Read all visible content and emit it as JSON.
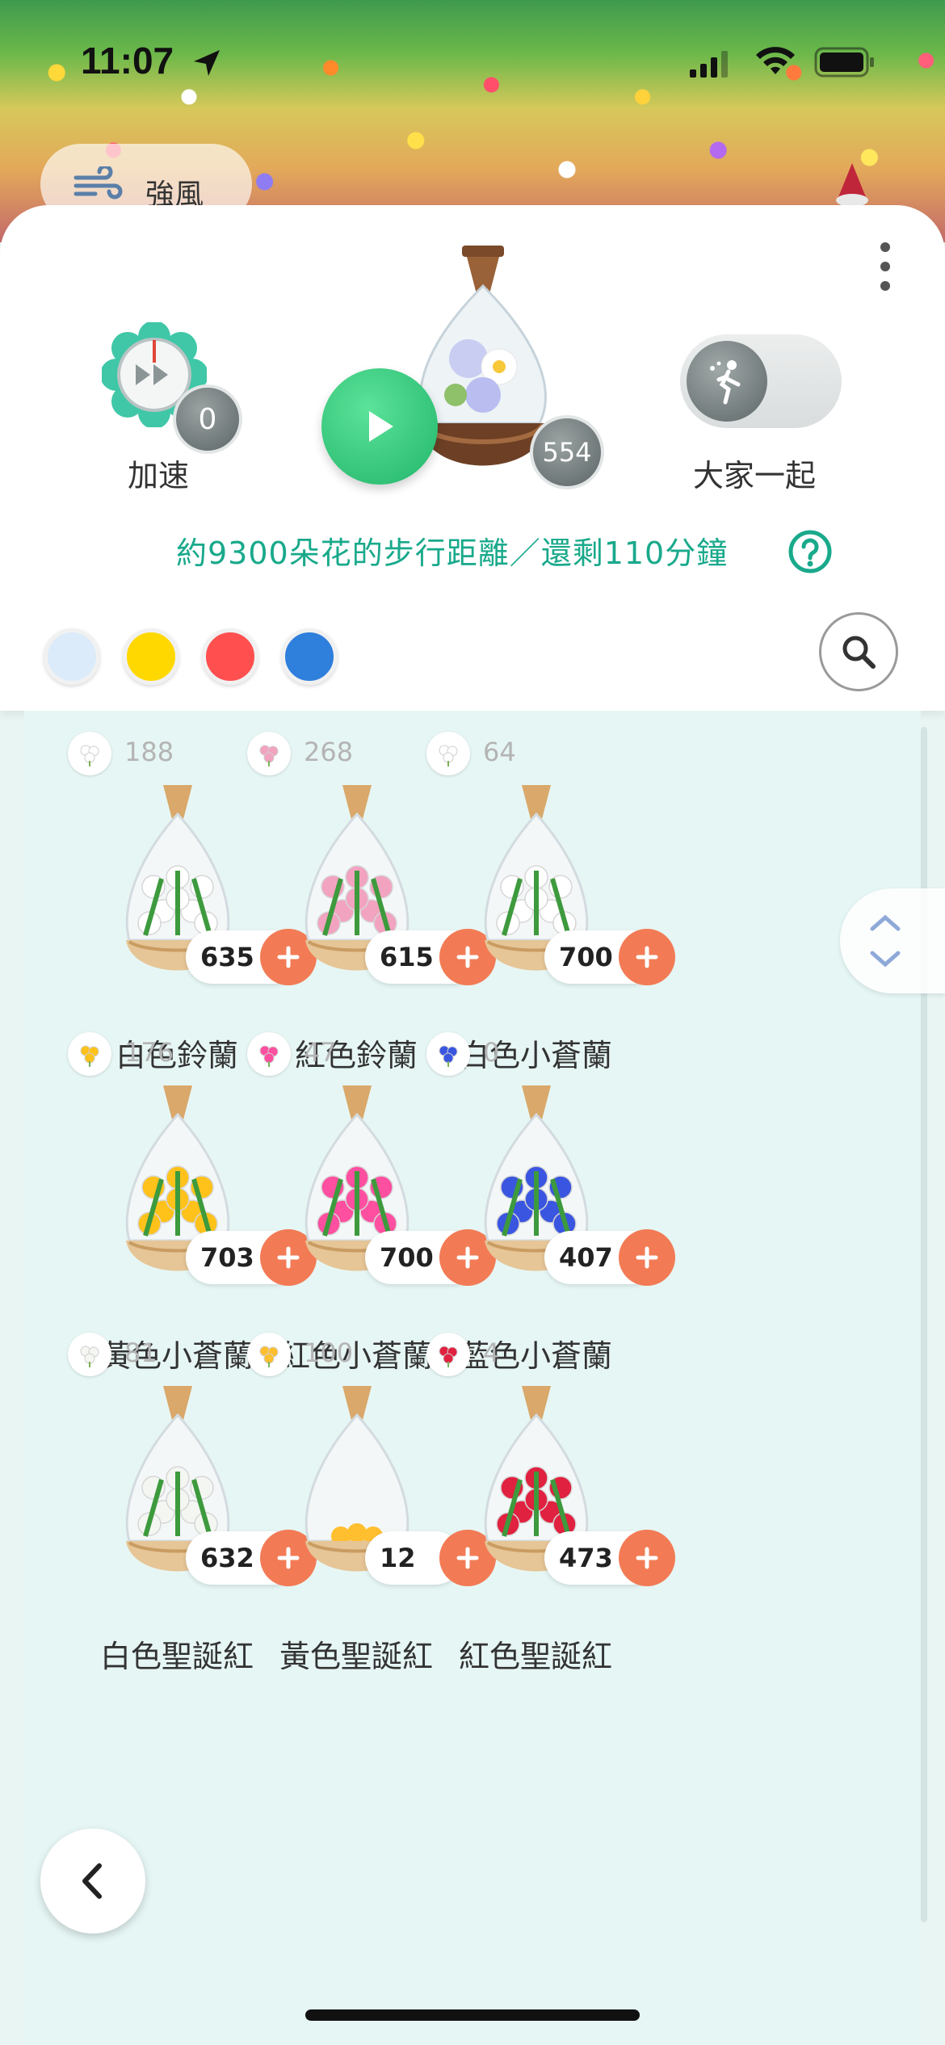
{
  "status_bar": {
    "time": "11:07"
  },
  "weather": {
    "label": "強風"
  },
  "header": {
    "speed_label": "加速",
    "speed_count": "0",
    "main_count": "554",
    "together_label": "大家一起",
    "walk_info": "約9300朵花的步行距離／還剩110分鐘"
  },
  "colors": {
    "filters": [
      "#dcebfa",
      "#ffd800",
      "#ff4f4f",
      "#2f7fdc"
    ],
    "accent": "#19a98b",
    "add_button": "#f27b55"
  },
  "flowers": [
    {
      "name": "白色鈴蘭",
      "seeds": "188",
      "count": "635",
      "color": "#ffffff"
    },
    {
      "name": "紅色鈴蘭",
      "seeds": "268",
      "count": "615",
      "color": "#f2a3c0"
    },
    {
      "name": "白色小蒼蘭",
      "seeds": "64",
      "count": "700",
      "color": "#ffffff"
    },
    {
      "name": "黃色小蒼蘭",
      "seeds": "176",
      "count": "703",
      "color": "#ffc21a"
    },
    {
      "name": "紅色小蒼蘭",
      "seeds": "47",
      "count": "700",
      "color": "#ff4fa0"
    },
    {
      "name": "藍色小蒼蘭",
      "seeds": "0",
      "count": "407",
      "color": "#3a56e0"
    },
    {
      "name": "白色聖誕紅",
      "seeds": "81",
      "count": "632",
      "color": "#f4f6f2"
    },
    {
      "name": "黃色聖誕紅",
      "seeds": "100",
      "count": "12",
      "color": "#ffbf2e"
    },
    {
      "name": "紅色聖誕紅",
      "seeds": "4",
      "count": "473",
      "color": "#e0213f"
    }
  ]
}
